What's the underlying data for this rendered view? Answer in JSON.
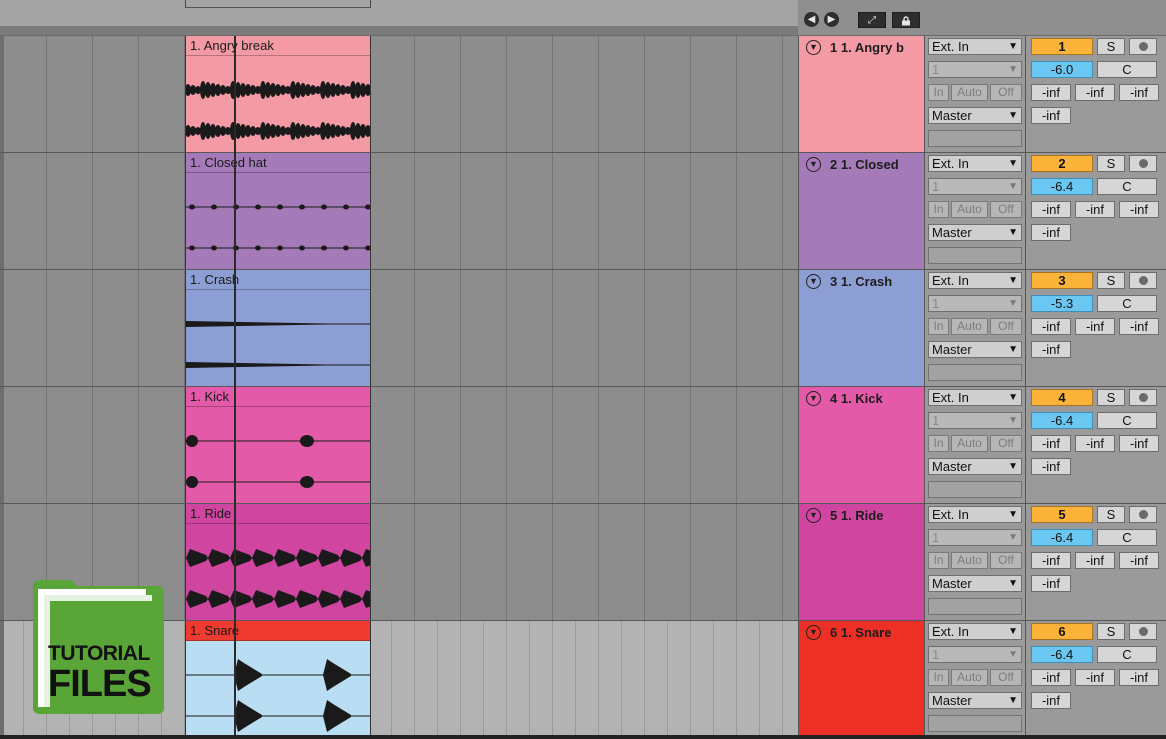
{
  "colors": {
    "track_1": "#f49aa4",
    "track_2": "#a57ab8",
    "track_3": "#8c9ed3",
    "track_4": "#e25aa8",
    "track_5": "#cf45a0",
    "track_6_header": "#ec3026",
    "track_6_clip_head": "#ee3a2f",
    "track_6_clip_body": "#b9def3",
    "track_number_highlight": "#fcb33a",
    "volume_highlight": "#69c7f2"
  },
  "top_controls": {
    "icons": [
      "left-arrow-icon",
      "right-arrow-icon",
      "expand-icon",
      "lock-icon"
    ]
  },
  "common": {
    "input_type": "Ext. In",
    "input_channel": "1",
    "monitor_in": "In",
    "monitor_auto": "Auto",
    "monitor_off": "Off",
    "output": "Master",
    "solo": "S",
    "pan": "C",
    "meter_peak": "-inf",
    "send_a": "-inf",
    "send_b": "-inf",
    "send_c": "-inf"
  },
  "tracks": [
    {
      "clip_name": "1. Angry break",
      "header_name": "1 1. Angry b",
      "number": "1",
      "volume": "-6.0"
    },
    {
      "clip_name": "1. Closed hat",
      "header_name": "2 1. Closed",
      "number": "2",
      "volume": "-6.4"
    },
    {
      "clip_name": "1. Crash",
      "header_name": "3 1. Crash",
      "number": "3",
      "volume": "-5.3"
    },
    {
      "clip_name": "1. Kick",
      "header_name": "4 1. Kick",
      "number": "4",
      "volume": "-6.4"
    },
    {
      "clip_name": "1. Ride",
      "header_name": "5 1. Ride",
      "number": "5",
      "volume": "-6.4"
    },
    {
      "clip_name": "1. Snare",
      "header_name": "6 1. Snare",
      "number": "6",
      "volume": "-6.4"
    }
  ],
  "badge": {
    "line1": "TUTORIAL",
    "line2": "FILES",
    "color": "#5aa537"
  }
}
